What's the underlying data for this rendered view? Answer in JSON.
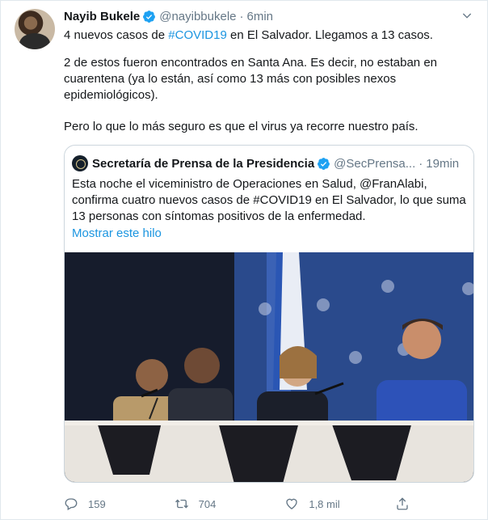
{
  "author": {
    "name": "Nayib Bukele",
    "handle": "@nayibbukele",
    "separator": "·",
    "time": "6min"
  },
  "tweet": {
    "line1_pre": "4 nuevos casos de ",
    "line1_tag": "#COVID19",
    "line1_post": " en El Salvador. Llegamos a 13 casos.",
    "para2": "2 de estos fueron encontrados en Santa Ana. Es decir, no estaban en cuarentena (ya lo están, así como 13 más con posibles nexos epidemiológicos).",
    "para3": "Pero lo que lo más seguro es que el virus ya recorre nuestro país."
  },
  "quote": {
    "name": "Secretaría de Prensa de la Presidencia",
    "handle": "@SecPrensa...",
    "separator": "·",
    "time": "19min",
    "text": "Esta noche el viceministro de Operaciones en Salud, @FranAlabi, confirma cuatro nuevos casos de #COVID19 en El Salvador, lo que suma 13 personas con síntomas positivos de la enfermedad.",
    "thread_link": "Mostrar este hilo"
  },
  "actions": {
    "replies": "159",
    "retweets": "704",
    "likes": "1,8 mil"
  },
  "icons": {
    "verified": "verified-badge-icon",
    "menu": "chevron-down-icon",
    "reply": "reply-icon",
    "retweet": "retweet-icon",
    "like": "heart-icon",
    "share": "share-icon"
  },
  "colors": {
    "link": "#1b95e0",
    "muted": "#657786",
    "verified": "#1da1f2"
  }
}
